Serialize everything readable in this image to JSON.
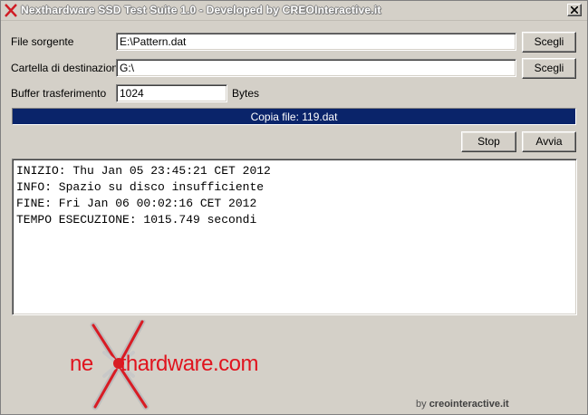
{
  "window": {
    "title": "Nexthardware SSD Test Suite 1.0 - Developed by CREOInteractive.it"
  },
  "form": {
    "source_label": "File sorgente",
    "source_value": "E:\\Pattern.dat",
    "dest_label": "Cartella di destinazione",
    "dest_value": "G:\\",
    "buffer_label": "Buffer trasferimento",
    "buffer_value": "1024",
    "buffer_unit": "Bytes",
    "browse_label": "Scegli"
  },
  "progress": {
    "text": "Copia file: 119.dat",
    "fraction": 1.0
  },
  "actions": {
    "stop_label": "Stop",
    "start_label": "Avvia"
  },
  "log": {
    "lines": [
      "INIZIO: Thu Jan 05 23:45:21 CET 2012",
      "INFO: Spazio su disco insufficiente",
      "FINE: Fri Jan 06 00:02:16 CET 2012",
      "TEMPO ESECUZIONE: 1015.749 secondi"
    ]
  },
  "branding": {
    "logo_ne": "ne",
    "logo_rest": "thardware",
    "logo_com": ".com",
    "byline_prefix": "by ",
    "byline_site": "creointeractive.it"
  },
  "colors": {
    "progress_fill": "#0a246a",
    "brand_red": "#e0141e"
  },
  "icons": {
    "app": "nexthardware-x-icon",
    "close": "close-icon"
  }
}
